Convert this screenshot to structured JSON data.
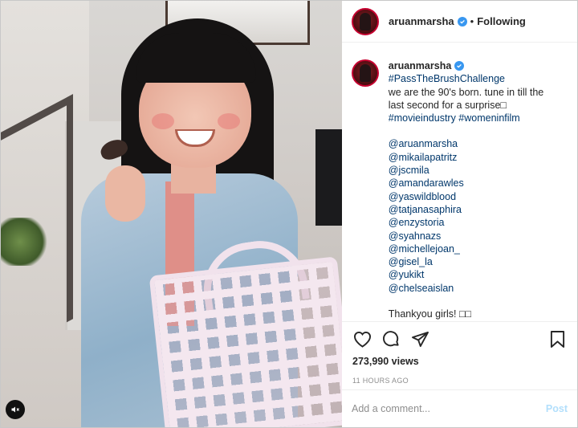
{
  "post": {
    "username": "aruanmarsha",
    "follow_separator": "•",
    "follow_status": "Following",
    "caption": {
      "username": "aruanmarsha",
      "hashtag_title": "#PassTheBrushChallenge",
      "line1": "we are the 90's born. tune in till the",
      "line2": "last second for a surprise□",
      "hashtags": "#movieindustry #womeninfilm",
      "mentions": [
        "@aruanmarsha",
        "@mikailapatritz",
        "@jscmila",
        "@amandarawles",
        "@yaswildblood",
        "@tatjanasaphira",
        "@enzystoria",
        "@syahnazs",
        "@michellejoan_",
        "@gisel_la",
        "@yukikt",
        "@chelseaislan"
      ],
      "closing": "Thankyou girls! □□"
    },
    "views": "273,990 views",
    "time_ago": "11 HOURS AGO",
    "comment": {
      "placeholder": "Add a comment...",
      "post_label": "Post"
    }
  },
  "icons": {
    "like": "heart-icon",
    "comment": "comment-icon",
    "share": "share-icon",
    "save": "bookmark-icon",
    "verified": "verified-badge-icon",
    "mute": "mute-icon"
  },
  "colors": {
    "link": "#00376b",
    "verified": "#3897f0",
    "post_disabled": "#b2dffc",
    "muted_text": "#8e8e8e"
  }
}
